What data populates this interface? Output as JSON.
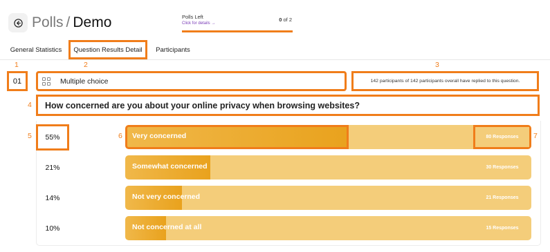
{
  "header": {
    "breadcrumb": "Polls",
    "separator": "/",
    "title": "Demo"
  },
  "polls_left": {
    "label": "Polls Left",
    "link": "Click for details →",
    "used": "0",
    "of_label": "of",
    "total": "2"
  },
  "tabs": [
    {
      "label": "General Statistics",
      "active": false
    },
    {
      "label": "Question Results Detail",
      "active": true
    },
    {
      "label": "Participants",
      "active": false
    }
  ],
  "annotations": [
    "1",
    "2",
    "3",
    "4",
    "5",
    "6",
    "7"
  ],
  "question": {
    "number": "01",
    "type_icon": "grid-icon",
    "type": "Multiple choice",
    "replies": "142 participants of 142 participants overall have replied to this question.",
    "text": "How concerned are you about your online privacy when browsing websites?"
  },
  "results": [
    {
      "percent_label": "55%",
      "percent": 55,
      "option": "Very concerned",
      "responses": "80 Responses"
    },
    {
      "percent_label": "21%",
      "percent": 21,
      "option": "Somewhat concerned",
      "responses": "30 Responses"
    },
    {
      "percent_label": "14%",
      "percent": 14,
      "option": "Not very concerned",
      "responses": "21 Responses"
    },
    {
      "percent_label": "10%",
      "percent": 10,
      "option": "Not concerned at all",
      "responses": "15 Responses"
    }
  ],
  "colors": {
    "highlight": "#f07d1a",
    "bar_track": "#f4cd7a",
    "bar_fill": "#e9a21d",
    "link": "#7a3db8"
  }
}
